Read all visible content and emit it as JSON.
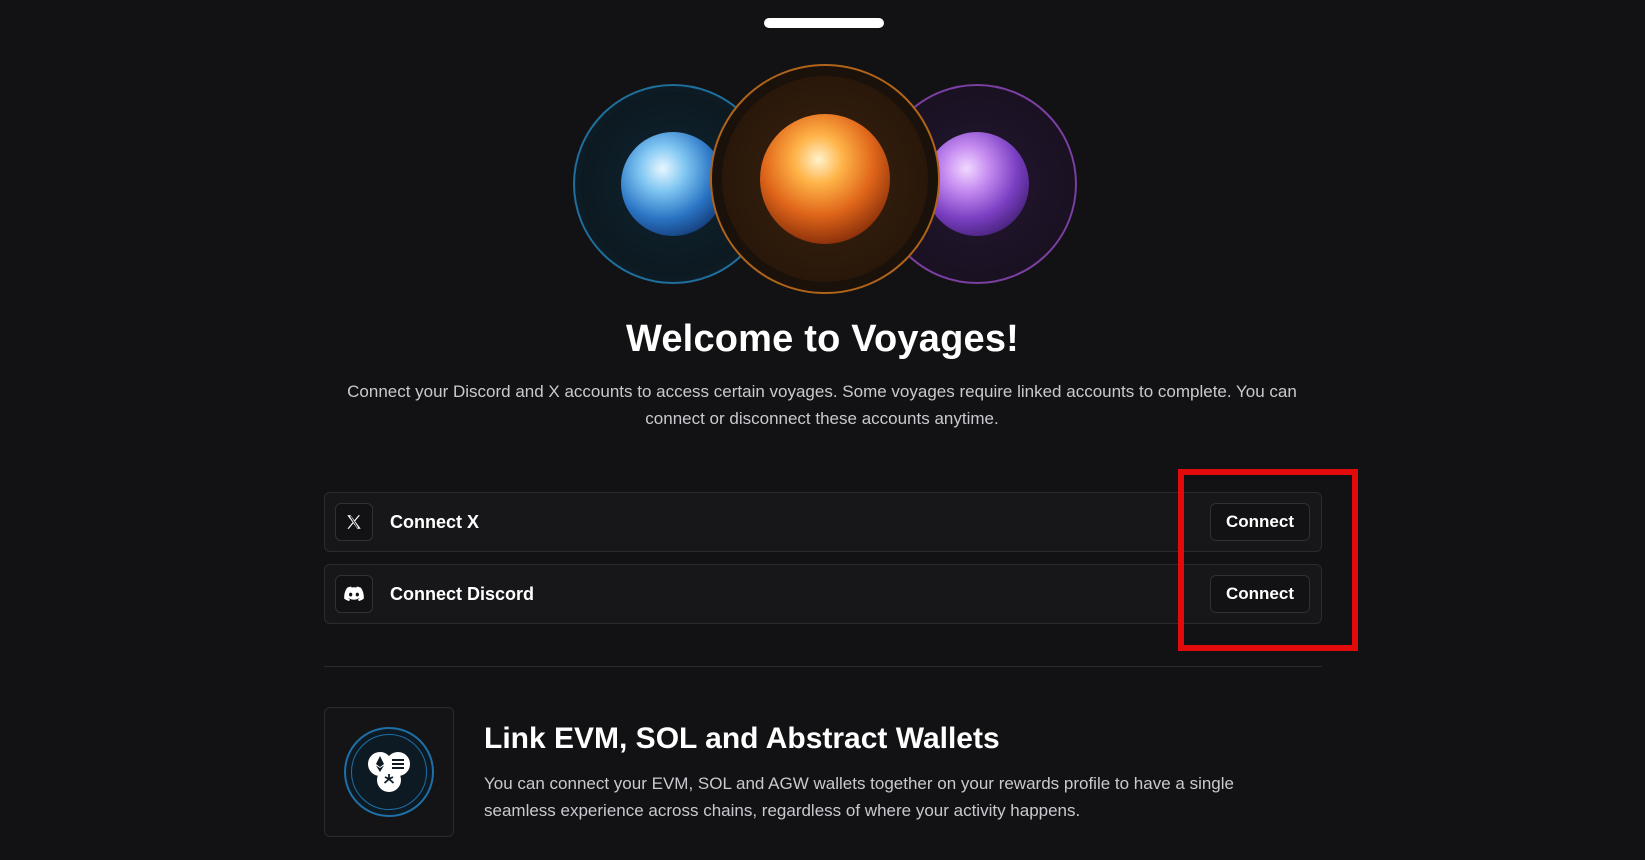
{
  "header": {
    "title": "Welcome to Voyages!",
    "subtitle": "Connect your Discord and X accounts to access certain voyages. Some voyages require linked accounts to complete. You can connect or disconnect these accounts anytime."
  },
  "accounts": [
    {
      "label": "Connect X",
      "icon": "x-logo-icon",
      "button_label": "Connect"
    },
    {
      "label": "Connect Discord",
      "icon": "discord-logo-icon",
      "button_label": "Connect"
    }
  ],
  "wallets": {
    "title": "Link EVM, SOL and Abstract Wallets",
    "description": "You can connect your EVM, SOL and AGW wallets together on your rewards profile to have a single seamless experience across chains, regardless of where your activity happens.",
    "icon": "multi-chain-wallet-icon"
  },
  "colors": {
    "background": "#121214",
    "highlight": "#e10b0b",
    "orb_blue": "#2a74c4",
    "orb_orange": "#e0661a",
    "orb_purple": "#7a3fc2"
  }
}
